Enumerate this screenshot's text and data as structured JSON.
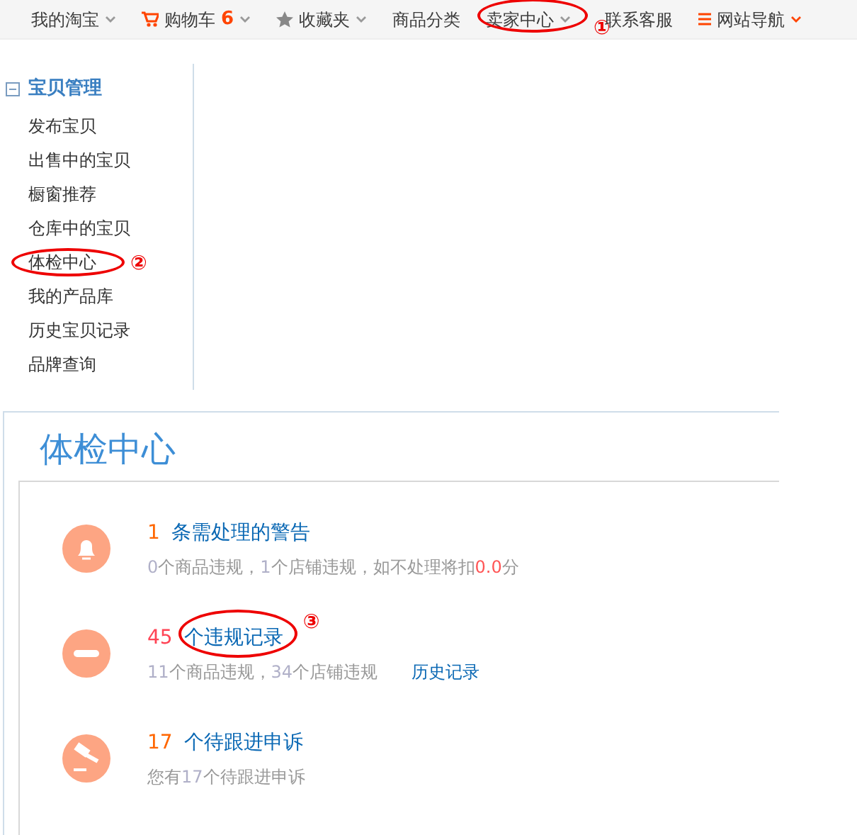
{
  "top_nav": [
    {
      "label": "我的淘宝",
      "caret": true,
      "circled": false
    },
    {
      "label": "购物车",
      "badge": "6",
      "caret": true,
      "circled": false
    },
    {
      "label": "收藏夹",
      "caret": true,
      "circled": false
    },
    {
      "label": "商品分类",
      "caret": false,
      "circled": false
    },
    {
      "label": "卖家中心",
      "caret": true,
      "circled": true,
      "marker": "①"
    },
    {
      "label": "联系客服",
      "caret": false,
      "circled": false
    },
    {
      "label": "网站导航",
      "caret": true,
      "circled": false
    }
  ],
  "sidebar": {
    "heading": "宝贝管理",
    "expanded": true,
    "items": [
      {
        "label": "发布宝贝",
        "circled": false
      },
      {
        "label": "出售中的宝贝",
        "circled": false
      },
      {
        "label": "橱窗推荐",
        "circled": false
      },
      {
        "label": "仓库中的宝贝",
        "circled": false
      },
      {
        "label": "体检中心",
        "circled": true,
        "marker": "②"
      },
      {
        "label": "我的产品库",
        "circled": false
      },
      {
        "label": "历史宝贝记录",
        "circled": false
      },
      {
        "label": "品牌查询",
        "circled": false
      }
    ]
  },
  "panel": {
    "title": "体检中心",
    "rows": [
      {
        "count": "1",
        "title": "条需处理的警告",
        "circled": false,
        "details": [
          {
            "kind": "num",
            "text": "0"
          },
          {
            "kind": "text",
            "text": "个商品违规，"
          },
          {
            "kind": "num",
            "text": "1"
          },
          {
            "kind": "text",
            "text": "个店铺违规，如不处理将扣"
          },
          {
            "kind": "penalty",
            "text": "0.0"
          },
          {
            "kind": "text",
            "text": "分"
          }
        ]
      },
      {
        "count": "45",
        "title": "个违规记录",
        "circled": true,
        "marker": "③",
        "details": [
          {
            "kind": "num",
            "text": "11"
          },
          {
            "kind": "text",
            "text": "个商品违规，"
          },
          {
            "kind": "num",
            "text": "34"
          },
          {
            "kind": "text",
            "text": "个店铺违规"
          }
        ],
        "link": "历史记录"
      },
      {
        "count": "17",
        "title": "个待跟进申诉",
        "circled": false,
        "details": [
          {
            "kind": "text",
            "text": "您有"
          },
          {
            "kind": "num",
            "text": "17"
          },
          {
            "kind": "text",
            "text": "个待跟进申诉"
          }
        ]
      }
    ]
  }
}
